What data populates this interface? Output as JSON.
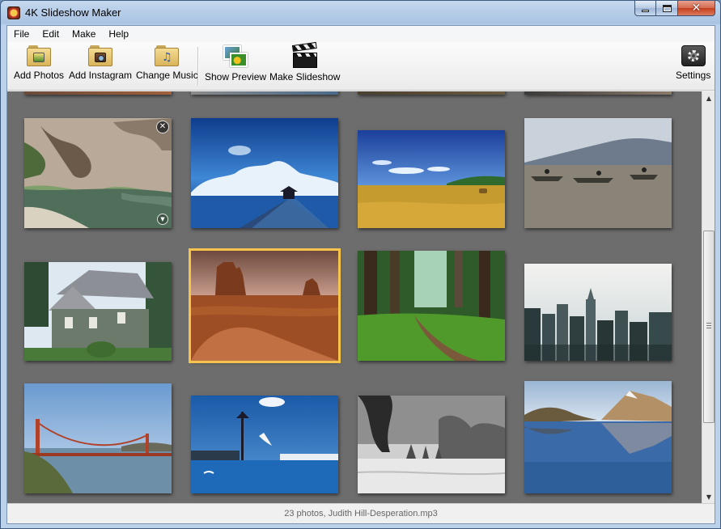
{
  "window": {
    "title": "4K Slideshow Maker"
  },
  "menu": [
    "File",
    "Edit",
    "Make",
    "Help"
  ],
  "toolbar": {
    "add_photos": "Add Photos",
    "add_instagram": "Add Instagram",
    "change_music": "Change Music",
    "show_preview": "Show Preview",
    "make_slideshow": "Make Slideshow",
    "settings": "Settings"
  },
  "photos": [
    {
      "subject": "rocky cliff lagoon",
      "selected": false
    },
    {
      "subject": "pier under blue sky",
      "selected": false
    },
    {
      "subject": "golden wheat field",
      "selected": false
    },
    {
      "subject": "boats on lake",
      "selected": false
    },
    {
      "subject": "wooden house",
      "selected": false
    },
    {
      "subject": "desert buttes",
      "selected": true
    },
    {
      "subject": "forest path",
      "selected": false
    },
    {
      "subject": "city skyline",
      "selected": false
    },
    {
      "subject": "golden gate bridge",
      "selected": false
    },
    {
      "subject": "harbor with seagull",
      "selected": false
    },
    {
      "subject": "snowy trees",
      "selected": false
    },
    {
      "subject": "mountain lake reflection",
      "selected": false
    }
  ],
  "status": {
    "text": "23 photos, Judith Hill-Desperation.mp3"
  },
  "colors": {
    "grid_background": "#6d6d6d",
    "selection": "#f4c44c"
  }
}
